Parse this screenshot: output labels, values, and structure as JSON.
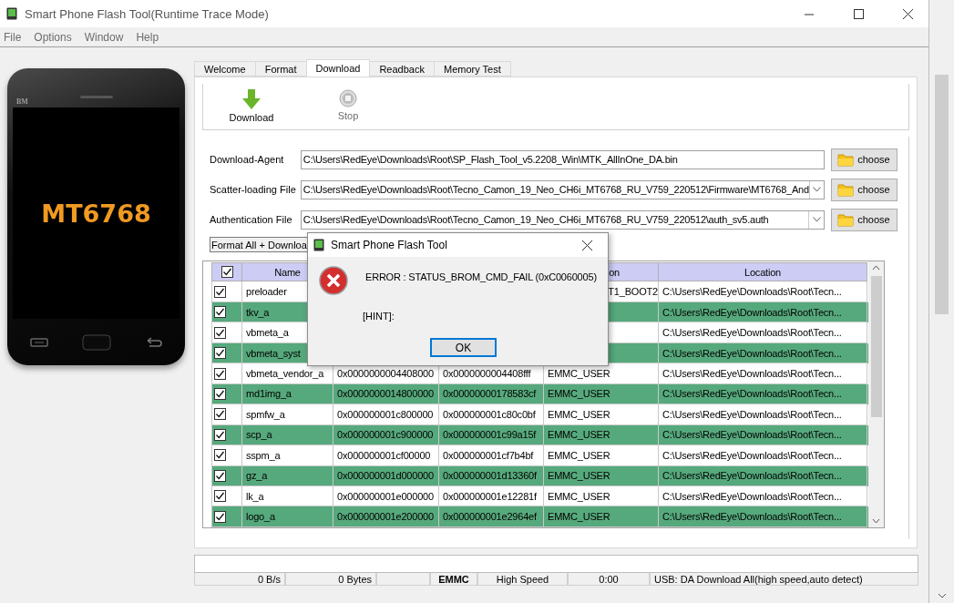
{
  "window": {
    "title": "Smart Phone Flash Tool(Runtime Trace Mode)"
  },
  "menu": [
    "File",
    "Options",
    "Window",
    "Help"
  ],
  "phone": {
    "brand": "BM",
    "chip": "MT6768"
  },
  "tabs": [
    {
      "label": "Welcome",
      "selected": false
    },
    {
      "label": "Format",
      "selected": false
    },
    {
      "label": "Download",
      "selected": true
    },
    {
      "label": "Readback",
      "selected": false
    },
    {
      "label": "Memory Test",
      "selected": false
    }
  ],
  "toolbar": [
    {
      "label": "Download",
      "kind": "download",
      "disabled": false
    },
    {
      "label": "Stop",
      "kind": "stop",
      "disabled": true
    }
  ],
  "files": [
    {
      "label": "Download-Agent",
      "kind": "text",
      "value": "C:\\Users\\RedEye\\Downloads\\Root\\SP_Flash_Tool_v5.2208_Win\\MTK_AllInOne_DA.bin",
      "button": "choose"
    },
    {
      "label": "Scatter-loading File",
      "kind": "combo",
      "value": "C:\\Users\\RedEye\\Downloads\\Root\\Tecno_Camon_19_Neo_CH6i_MT6768_RU_V759_220512\\Firmware\\MT6768_And",
      "button": "choose"
    },
    {
      "label": "Authentication File",
      "kind": "combo",
      "value": "C:\\Users\\RedEye\\Downloads\\Root\\Tecno_Camon_19_Neo_CH6i_MT6768_RU_V759_220512\\auth_sv5.auth",
      "button": "choose"
    }
  ],
  "mode": {
    "value": "Format All + Downloa"
  },
  "table": {
    "all_checked": true,
    "columns": [
      {
        "label": "Name"
      },
      {},
      {},
      {
        "label": "on"
      },
      {
        "label": "Location"
      }
    ],
    "rows": [
      {
        "checked": true,
        "cells": [
          "preloader",
          null,
          null,
          "T1_BOOT2",
          "C:\\Users\\RedEye\\Downloads\\Root\\Tecn..."
        ]
      },
      {
        "checked": true,
        "cells": [
          "tkv_a",
          null,
          null,
          null,
          "C:\\Users\\RedEye\\Downloads\\Root\\Tecn..."
        ]
      },
      {
        "checked": true,
        "cells": [
          "vbmeta_a",
          null,
          null,
          null,
          "C:\\Users\\RedEye\\Downloads\\Root\\Tecn..."
        ]
      },
      {
        "checked": true,
        "cells": [
          "vbmeta_syst",
          null,
          null,
          null,
          "C:\\Users\\RedEye\\Downloads\\Root\\Tecn..."
        ]
      },
      {
        "checked": true,
        "cells": [
          "vbmeta_vendor_a",
          "0x0000000004408000",
          "0x0000000004408fff",
          "EMMC_USER",
          "C:\\Users\\RedEye\\Downloads\\Root\\Tecn..."
        ]
      },
      {
        "checked": true,
        "cells": [
          "md1img_a",
          "0x0000000014800000",
          "0x00000000178583cf",
          "EMMC_USER",
          "C:\\Users\\RedEye\\Downloads\\Root\\Tecn..."
        ]
      },
      {
        "checked": true,
        "cells": [
          "spmfw_a",
          "0x000000001c800000",
          "0x000000001c80c0bf",
          "EMMC_USER",
          "C:\\Users\\RedEye\\Downloads\\Root\\Tecn..."
        ]
      },
      {
        "checked": true,
        "cells": [
          "scp_a",
          "0x000000001c900000",
          "0x000000001c99a15f",
          "EMMC_USER",
          "C:\\Users\\RedEye\\Downloads\\Root\\Tecn..."
        ]
      },
      {
        "checked": true,
        "cells": [
          "sspm_a",
          "0x000000001cf00000",
          "0x000000001cf7b4bf",
          "EMMC_USER",
          "C:\\Users\\RedEye\\Downloads\\Root\\Tecn..."
        ]
      },
      {
        "checked": true,
        "cells": [
          "gz_a",
          "0x000000001d000000",
          "0x000000001d13360f",
          "EMMC_USER",
          "C:\\Users\\RedEye\\Downloads\\Root\\Tecn..."
        ]
      },
      {
        "checked": true,
        "cells": [
          "lk_a",
          "0x000000001e000000",
          "0x000000001e12281f",
          "EMMC_USER",
          "C:\\Users\\RedEye\\Downloads\\Root\\Tecn..."
        ]
      },
      {
        "checked": true,
        "cells": [
          "logo_a",
          "0x000000001e200000",
          "0x000000001e2964ef",
          "EMMC_USER",
          "C:\\Users\\RedEye\\Downloads\\Root\\Tecn..."
        ]
      }
    ]
  },
  "progress": {
    "level": 0
  },
  "status_bar": [
    {
      "text": "0 B/s",
      "bold": false
    },
    {
      "text": "0 Bytes",
      "bold": false
    },
    {
      "text": "EMMC",
      "bold": true
    },
    {
      "text": "High Speed",
      "bold": false
    },
    {
      "text": "0:00",
      "bold": false
    },
    {
      "text": "USB: DA Download All(high speed,auto detect)",
      "bold": false
    }
  ],
  "dialog": {
    "title": "Smart Phone Flash Tool",
    "message": "ERROR : STATUS_BROM_CMD_FAIL (0xC0060005)",
    "hint": "[HINT]:",
    "button": "OK"
  }
}
